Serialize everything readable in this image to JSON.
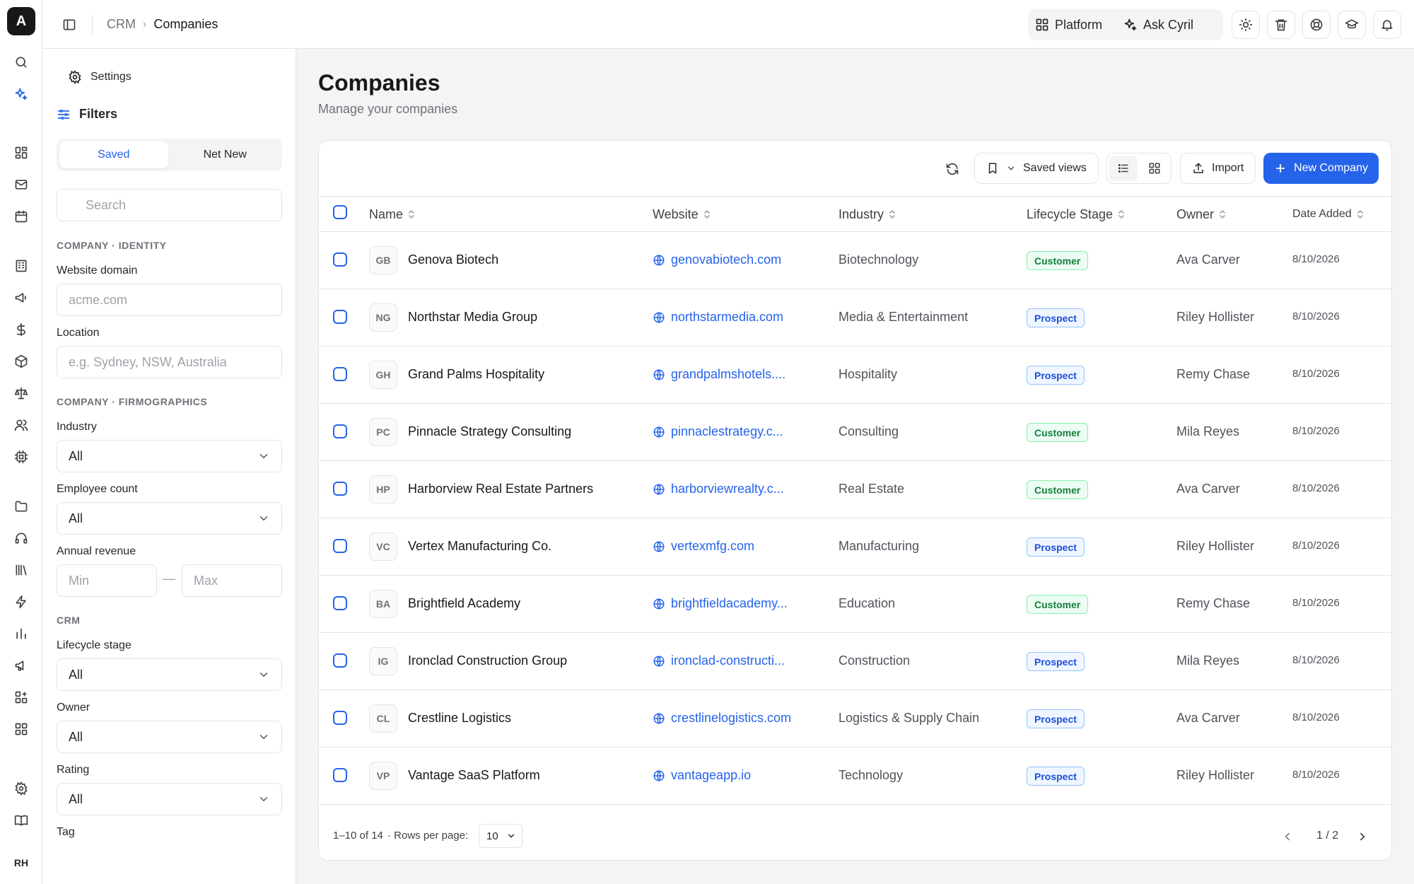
{
  "app": {
    "logo_letter": "A",
    "user_initials": "RH"
  },
  "breadcrumb": {
    "parent": "CRM",
    "separator": "›",
    "current": "Companies"
  },
  "topbar": {
    "platform_label": "Platform",
    "ask_label": "Ask Cyril"
  },
  "filters": {
    "settings_label": "Settings",
    "title": "Filters",
    "tabs": [
      {
        "label": "Saved",
        "active": true
      },
      {
        "label": "Net New",
        "active": false
      }
    ],
    "search_placeholder": "Search",
    "section_identity": "COMPANY · IDENTITY",
    "website_domain_label": "Website domain",
    "website_domain_placeholder": "acme.com",
    "location_label": "Location",
    "location_placeholder": "e.g. Sydney, NSW, Australia",
    "section_firmographics": "COMPANY · FIRMOGRAPHICS",
    "industry_label": "Industry",
    "industry_value": "All",
    "employee_label": "Employee count",
    "employee_value": "All",
    "revenue_label": "Annual revenue",
    "revenue_min_placeholder": "Min",
    "revenue_max_placeholder": "Max",
    "range_separator": "—",
    "section_crm": "CRM",
    "lifecycle_label": "Lifecycle stage",
    "lifecycle_value": "All",
    "owner_label": "Owner",
    "owner_value": "All",
    "rating_label": "Rating",
    "rating_value": "All",
    "tag_label": "Tag"
  },
  "page": {
    "title": "Companies",
    "subtitle": "Manage your companies"
  },
  "toolbar": {
    "saved_views_label": "Saved views",
    "import_label": "Import",
    "new_company_label": "New Company"
  },
  "table": {
    "columns": [
      "Name",
      "Website",
      "Industry",
      "Lifecycle Stage",
      "Owner",
      "Date Added"
    ],
    "rows": [
      {
        "initials": "GB",
        "name": "Genova Biotech",
        "website": "genovabiotech.com",
        "industry": "Biotechnology",
        "stage": "Customer",
        "owner": "Ava Carver",
        "date": "8/10/2026"
      },
      {
        "initials": "NG",
        "name": "Northstar Media Group",
        "website": "northstarmedia.com",
        "industry": "Media & Entertainment",
        "stage": "Prospect",
        "owner": "Riley Hollister",
        "date": "8/10/2026"
      },
      {
        "initials": "GH",
        "name": "Grand Palms Hospitality",
        "website": "grandpalmshotels....",
        "industry": "Hospitality",
        "stage": "Prospect",
        "owner": "Remy Chase",
        "date": "8/10/2026"
      },
      {
        "initials": "PC",
        "name": "Pinnacle Strategy Consulting",
        "website": "pinnaclestrategy.c...",
        "industry": "Consulting",
        "stage": "Customer",
        "owner": "Mila Reyes",
        "date": "8/10/2026"
      },
      {
        "initials": "HP",
        "name": "Harborview Real Estate Partners",
        "website": "harborviewrealty.c...",
        "industry": "Real Estate",
        "stage": "Customer",
        "owner": "Ava Carver",
        "date": "8/10/2026"
      },
      {
        "initials": "VC",
        "name": "Vertex Manufacturing Co.",
        "website": "vertexmfg.com",
        "industry": "Manufacturing",
        "stage": "Prospect",
        "owner": "Riley Hollister",
        "date": "8/10/2026"
      },
      {
        "initials": "BA",
        "name": "Brightfield Academy",
        "website": "brightfieldacademy...",
        "industry": "Education",
        "stage": "Customer",
        "owner": "Remy Chase",
        "date": "8/10/2026"
      },
      {
        "initials": "IG",
        "name": "Ironclad Construction Group",
        "website": "ironclad-constructi...",
        "industry": "Construction",
        "stage": "Prospect",
        "owner": "Mila Reyes",
        "date": "8/10/2026"
      },
      {
        "initials": "CL",
        "name": "Crestline Logistics",
        "website": "crestlinelogistics.com",
        "industry": "Logistics & Supply Chain",
        "stage": "Prospect",
        "owner": "Ava Carver",
        "date": "8/10/2026"
      },
      {
        "initials": "VP",
        "name": "Vantage SaaS Platform",
        "website": "vantageapp.io",
        "industry": "Technology",
        "stage": "Prospect",
        "owner": "Riley Hollister",
        "date": "8/10/2026"
      }
    ]
  },
  "stage_styles": {
    "Customer": {
      "bg": "#ecfdf3",
      "border": "#86efac",
      "color": "#15803d"
    },
    "Prospect": {
      "bg": "#eff6ff",
      "border": "#93c5fd",
      "color": "#1d4ed8"
    }
  },
  "footer": {
    "range": "1–10 of 14",
    "rows_per_page_label": "· Rows per page:",
    "rows_per_page_value": "10",
    "page_indicator": "1 / 2"
  },
  "colors": {
    "accent": "#2563eb"
  }
}
